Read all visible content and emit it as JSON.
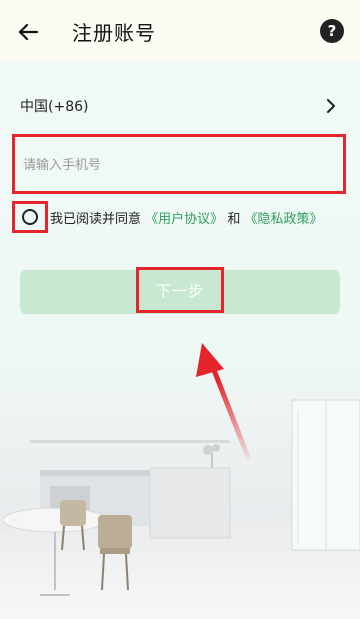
{
  "header": {
    "title": "注册账号",
    "help_label": "?"
  },
  "country": {
    "label": "中国(+86)"
  },
  "phone": {
    "placeholder": "请输入手机号",
    "value": ""
  },
  "agreement": {
    "prefix": "我已阅读并同意",
    "terms_link": "《用户协议》",
    "conjunction": "和",
    "privacy_link": "《隐私政策》",
    "checked": false
  },
  "next_button": {
    "label": "下一步"
  },
  "colors": {
    "accent_green": "#2f9e5b",
    "button_disabled": "#c8e8d2",
    "annotation_red": "#e5242b",
    "header_bg": "#fbfbf3"
  },
  "icons": {
    "back": "arrow-left-icon",
    "help": "question-circle-icon",
    "chevron": "chevron-right-icon",
    "annotation": "red-arrow-icon"
  }
}
